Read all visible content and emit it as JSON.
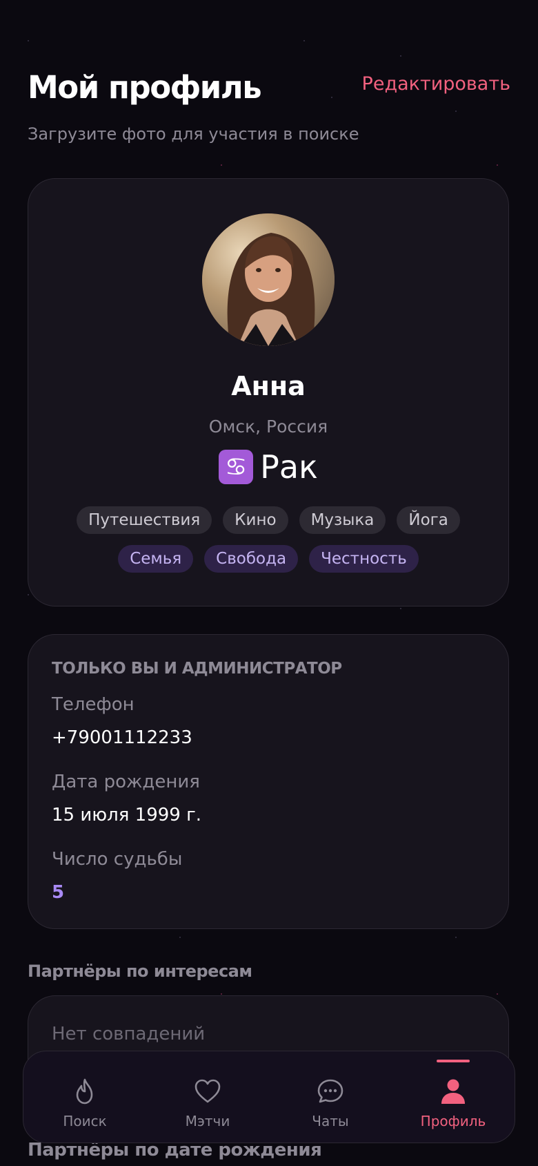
{
  "header": {
    "title": "Мой профиль",
    "edit_label": "Редактировать",
    "subtitle": "Загрузите фото для участия в поиске"
  },
  "profile": {
    "name": "Анна",
    "location": "Омск, Россия",
    "zodiac_symbol": "♋",
    "zodiac_name": "Рак",
    "interests": [
      "Путешествия",
      "Кино",
      "Музыка",
      "Йога"
    ],
    "values": [
      "Семья",
      "Свобода",
      "Честность"
    ]
  },
  "private_info": {
    "section_label": "ТОЛЬКО ВЫ И АДМИНИСТРАТОР",
    "phone_label": "Телефон",
    "phone_value": "+79001112233",
    "birthdate_label": "Дата рождения",
    "birthdate_value": "15 июля 1999 г.",
    "destiny_label": "Число судьбы",
    "destiny_value": "5"
  },
  "partners_interests": {
    "heading": "Партнёры по интересам",
    "empty_text": "Нет совпадений"
  },
  "partners_birthdate": {
    "heading": "Партнёры по дате рождения"
  },
  "nav": {
    "items": [
      {
        "label": "Поиск",
        "icon": "flame-icon"
      },
      {
        "label": "Мэтчи",
        "icon": "heart-icon"
      },
      {
        "label": "Чаты",
        "icon": "chat-bubble-icon"
      },
      {
        "label": "Профиль",
        "icon": "user-icon"
      }
    ],
    "active": "Профиль"
  },
  "colors": {
    "background": "#0b0910",
    "accent": "#f2617f",
    "card": "#17141d",
    "purple_accent": "#a98af5"
  }
}
